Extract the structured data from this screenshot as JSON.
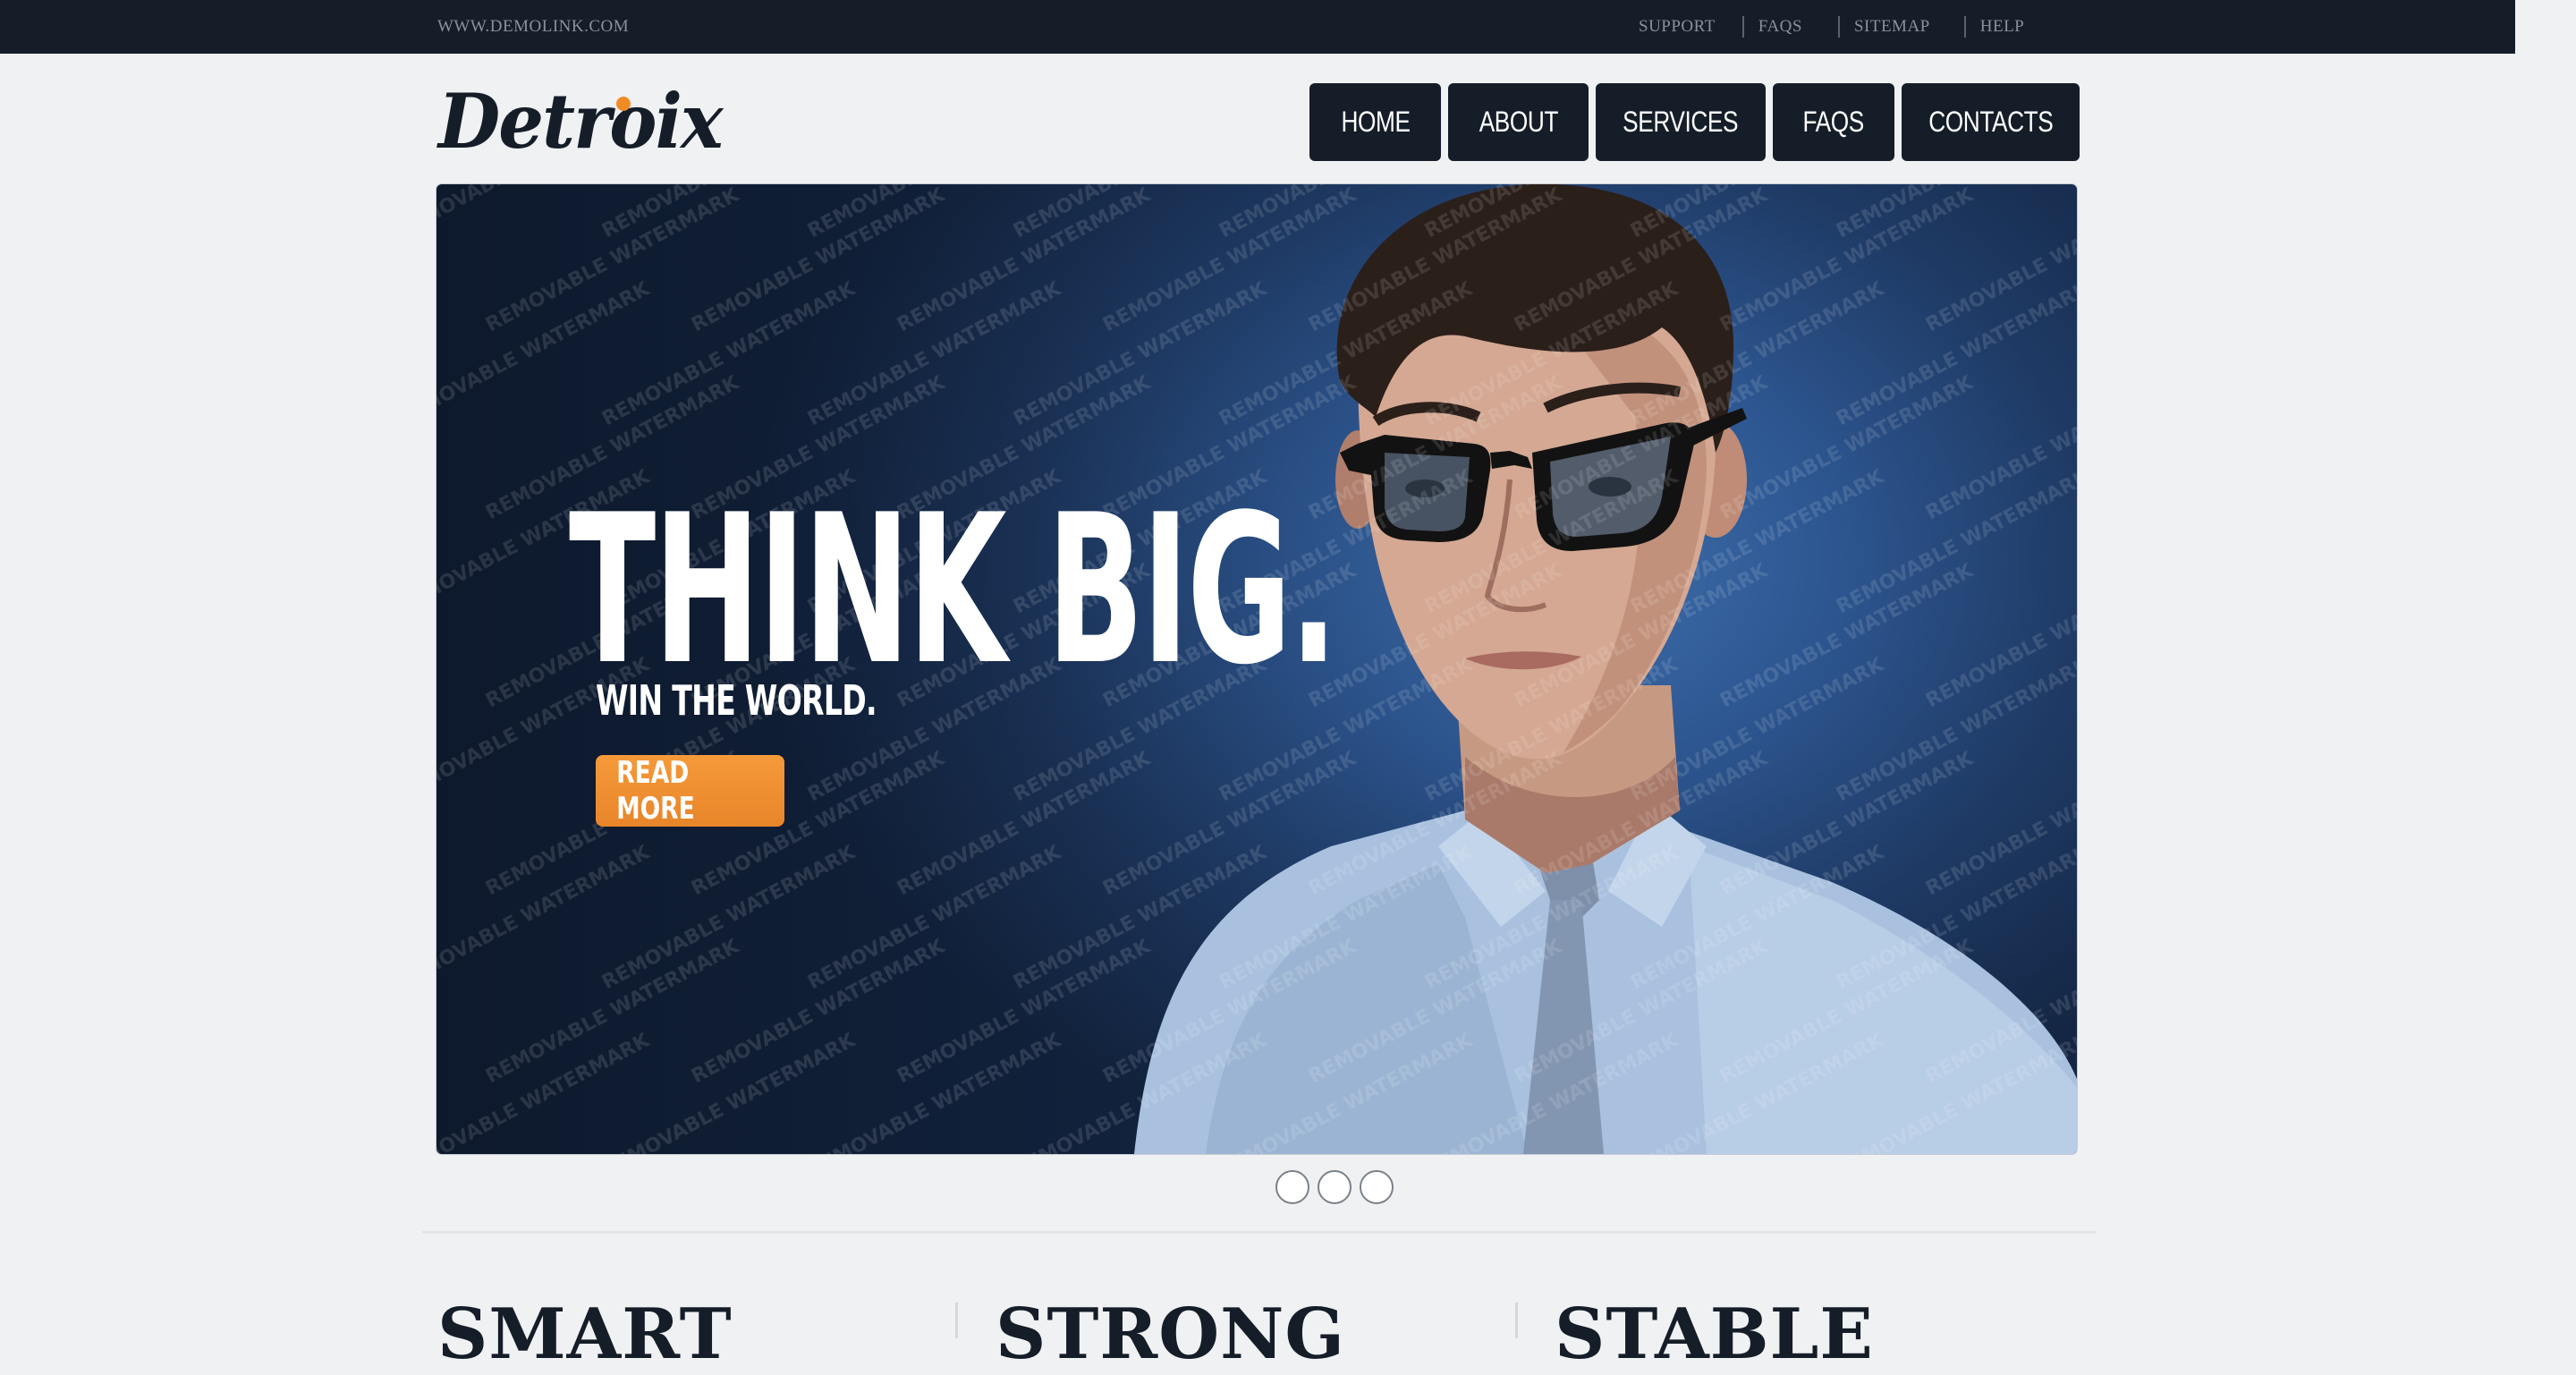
{
  "topbar": {
    "site_link": "WWW.DEMOLINK.COM",
    "links": [
      "SUPPORT",
      "FAQS",
      "SITEMAP",
      "HELP"
    ]
  },
  "header": {
    "logo_text": "Detroix",
    "nav": [
      "HOME",
      "ABOUT",
      "SERVICES",
      "FAQS",
      "CONTACTS"
    ]
  },
  "hero": {
    "title": "THINK BIG.",
    "subtitle": "WIN THE WORLD.",
    "cta_label": "READ MORE",
    "watermark_text": "REMOVABLE WATERMARK",
    "slides": 3
  },
  "features": {
    "titles": [
      "SMART",
      "STRONG",
      "STABLE"
    ]
  },
  "colors": {
    "dark": "#151d28",
    "accent": "#f08c26",
    "background": "#f0f1f3"
  }
}
